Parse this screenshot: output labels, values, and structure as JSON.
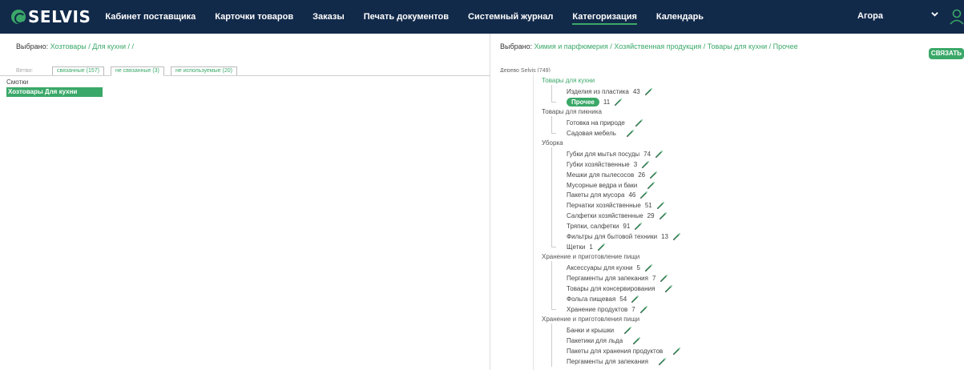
{
  "topbar": {
    "logo_text": "SELVIS",
    "nav": [
      "Кабинет поставщика",
      "Карточки товаров",
      "Заказы",
      "Печать документов",
      "Системный журнал",
      "Категоризация",
      "Календарь"
    ],
    "active_nav": "Категоризация",
    "user": "Агора"
  },
  "left": {
    "selected_prefix": "Выбрано:",
    "selected_path": "Хозтовары / Для кухни / /",
    "branches_label": "Ветви:",
    "tabs": [
      "связанные (157)",
      "не связанные (3)",
      "не используемые (20)"
    ],
    "active_tab": "не связанные (3)",
    "rows": [
      "Смотки"
    ],
    "selected_row": "Хозтовары  Для кухни"
  },
  "right": {
    "selected_prefix": "Выбрано:",
    "selected_path": "Химия и парфюмерия / Хозяйственная продукция / Товары для кухни / Прочее",
    "bind_button": "СВЯЗАТЬ",
    "tree_label": "Дерево Selvis (749)",
    "tree": [
      {
        "type": "group",
        "label": "Товары для кухни",
        "active": true
      },
      {
        "type": "item",
        "label": "Изделия из пластика",
        "count": "43"
      },
      {
        "type": "item",
        "label": "Прочее",
        "count": "11",
        "selected": true,
        "last": true
      },
      {
        "type": "group",
        "label": "Товары для пикника"
      },
      {
        "type": "item",
        "label": "Готовка на природе",
        "count": ""
      },
      {
        "type": "item",
        "label": "Садовая мебель",
        "count": "",
        "last": true
      },
      {
        "type": "group",
        "label": "Уборка"
      },
      {
        "type": "item",
        "label": "Губки для мытья посуды",
        "count": "74"
      },
      {
        "type": "item",
        "label": "Губки хозяйственные",
        "count": "3"
      },
      {
        "type": "item",
        "label": "Мешки для пылесосов",
        "count": "26"
      },
      {
        "type": "item",
        "label": "Мусорные ведра и баки",
        "count": ""
      },
      {
        "type": "item",
        "label": "Пакеты для мусора",
        "count": "46"
      },
      {
        "type": "item",
        "label": "Перчатки хозяйственные",
        "count": "51"
      },
      {
        "type": "item",
        "label": "Салфетки хозяйственные",
        "count": "29"
      },
      {
        "type": "item",
        "label": "Тряпки, салфетки",
        "count": "91"
      },
      {
        "type": "item",
        "label": "Фильтры для бытовой техники",
        "count": "13"
      },
      {
        "type": "item",
        "label": "Щетки",
        "count": "1",
        "last": true
      },
      {
        "type": "group",
        "label": "Хранение и приготовление пищи"
      },
      {
        "type": "item",
        "label": "Аксессуары для кухни",
        "count": "5"
      },
      {
        "type": "item",
        "label": "Пергаменты для запекания",
        "count": "7"
      },
      {
        "type": "item",
        "label": "Товары для консервирования",
        "count": ""
      },
      {
        "type": "item",
        "label": "Фольга пищевая",
        "count": "54"
      },
      {
        "type": "item",
        "label": "Хранение продуктов",
        "count": "7",
        "last": true
      },
      {
        "type": "group",
        "label": "Хранение и приготовления пищи"
      },
      {
        "type": "item",
        "label": "Банки и крышки",
        "count": ""
      },
      {
        "type": "item",
        "label": "Пакетики для льда",
        "count": ""
      },
      {
        "type": "item",
        "label": "Пакеты для хранения продуктов",
        "count": ""
      },
      {
        "type": "item",
        "label": "Пергаменты для запекания",
        "count": ""
      }
    ]
  },
  "colors": {
    "topbar": "#122a4a",
    "accent": "#3aa868",
    "pencil": "#2e7d4f"
  }
}
